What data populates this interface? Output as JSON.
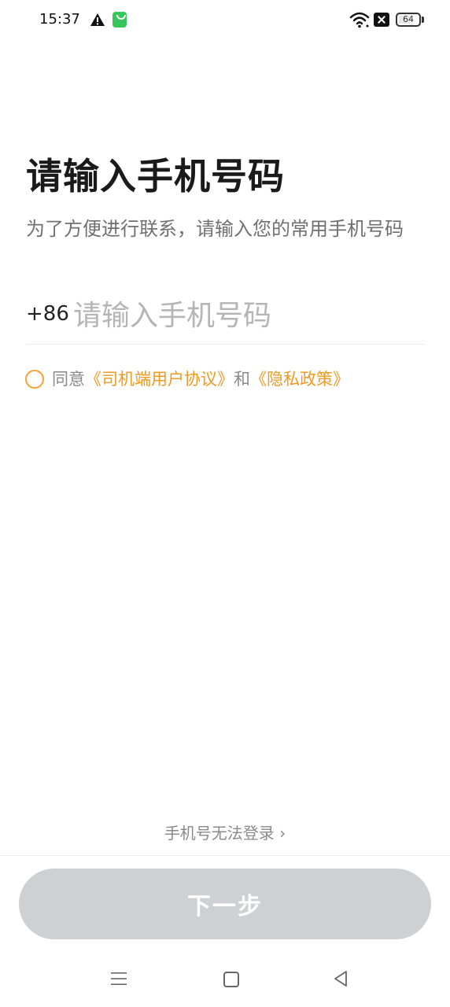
{
  "status_bar": {
    "time": "15:37",
    "icons": [
      "warning-icon",
      "app-notification-icon",
      "wifi-icon",
      "sim-icon",
      "battery-icon"
    ],
    "battery_level": "64",
    "battery_percent": 64
  },
  "header": {
    "title": "请输入手机号码",
    "subtitle": "为了方便进行联系，请输入您的常用手机号码"
  },
  "phone_field": {
    "country_code": "+86",
    "value": "",
    "placeholder": "请输入手机号码"
  },
  "agreement": {
    "checked": false,
    "prefix": "同意",
    "link1": "《司机端用户协议》",
    "connector": "和",
    "link2": "《隐私政策》"
  },
  "cannot_login_label": "手机号无法登录 ›",
  "next_button_label": "下一步",
  "colors": {
    "accent": "#ef9a21",
    "button_disabled": "#cfd0d3",
    "subtext": "#707070"
  }
}
